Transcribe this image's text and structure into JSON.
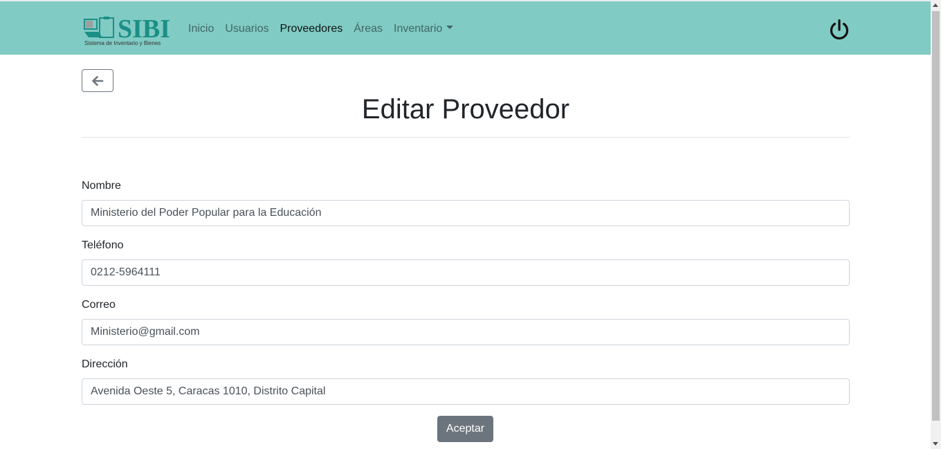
{
  "navbar": {
    "brand_title": "SIBI",
    "brand_subtitle": "Sistema de Inventario y Bienes",
    "links": [
      {
        "label": "Inicio",
        "active": false
      },
      {
        "label": "Usuarios",
        "active": false
      },
      {
        "label": "Proveedores",
        "active": true
      },
      {
        "label": "Áreas",
        "active": false
      },
      {
        "label": "Inventario",
        "active": false,
        "dropdown": true
      }
    ],
    "power_icon": "power-icon",
    "background_color": "#80cbc4"
  },
  "page": {
    "back_icon": "arrow-left-icon",
    "title": "Editar Proveedor"
  },
  "form": {
    "fields": [
      {
        "label": "Nombre",
        "value": "Ministerio del Poder Popular para la Educación"
      },
      {
        "label": "Teléfono",
        "value": "0212-5964111"
      },
      {
        "label": "Correo",
        "value": "Ministerio@gmail.com"
      },
      {
        "label": "Dirección",
        "value": "Avenida Oeste 5, Caracas 1010, Distrito Capital"
      }
    ],
    "submit_label": "Aceptar"
  }
}
